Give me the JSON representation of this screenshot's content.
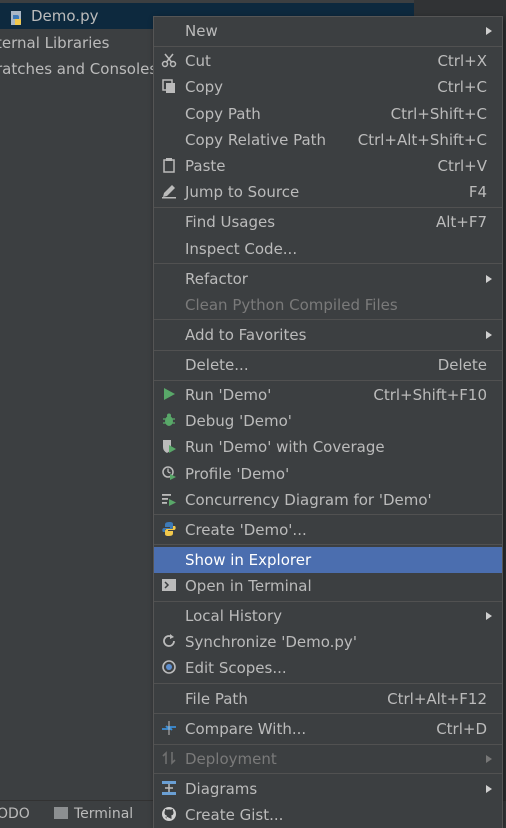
{
  "tree": {
    "items": [
      {
        "label": "Demo.py"
      },
      {
        "label": "ternal Libraries"
      },
      {
        "label": "ratches and Consoles"
      }
    ]
  },
  "bottom_bar": {
    "todo_label": "ODO",
    "terminal_label": "Terminal"
  },
  "menu": {
    "new": {
      "label": "New"
    },
    "cut": {
      "label": "Cut",
      "shortcut": "Ctrl+X"
    },
    "copy": {
      "label": "Copy",
      "shortcut": "Ctrl+C"
    },
    "copy_path": {
      "label": "Copy Path",
      "shortcut": "Ctrl+Shift+C"
    },
    "copy_relative_path": {
      "label": "Copy Relative Path",
      "shortcut": "Ctrl+Alt+Shift+C"
    },
    "paste": {
      "label": "Paste",
      "shortcut": "Ctrl+V"
    },
    "jump_to_source": {
      "label": "Jump to Source",
      "shortcut": "F4"
    },
    "find_usages": {
      "label": "Find Usages",
      "shortcut": "Alt+F7"
    },
    "inspect_code": {
      "label": "Inspect Code..."
    },
    "refactor": {
      "label": "Refactor"
    },
    "clean_python": {
      "label": "Clean Python Compiled Files"
    },
    "add_to_favorites": {
      "label": "Add to Favorites"
    },
    "delete": {
      "label": "Delete...",
      "shortcut": "Delete"
    },
    "run": {
      "label": "Run 'Demo'",
      "shortcut": "Ctrl+Shift+F10"
    },
    "debug": {
      "label": "Debug 'Demo'"
    },
    "run_coverage": {
      "label": "Run 'Demo' with Coverage"
    },
    "profile": {
      "label": "Profile 'Demo'"
    },
    "concurrency": {
      "label": "Concurrency Diagram for 'Demo'"
    },
    "create": {
      "label": "Create 'Demo'..."
    },
    "show_in_explorer": {
      "label": "Show in Explorer"
    },
    "open_in_terminal": {
      "label": "Open in Terminal"
    },
    "local_history": {
      "label": "Local History"
    },
    "synchronize": {
      "label": "Synchronize 'Demo.py'"
    },
    "edit_scopes": {
      "label": "Edit Scopes..."
    },
    "file_path": {
      "label": "File Path",
      "shortcut": "Ctrl+Alt+F12"
    },
    "compare_with": {
      "label": "Compare With...",
      "shortcut": "Ctrl+D"
    },
    "deployment": {
      "label": "Deployment"
    },
    "diagrams": {
      "label": "Diagrams"
    },
    "create_gist": {
      "label": "Create Gist..."
    }
  },
  "colors": {
    "menu_background": "#3c3f41",
    "highlight": "#4b6eaf",
    "run_green": "#59a869",
    "python_blue": "#3d7ab8",
    "python_yellow": "#f2c94c"
  }
}
